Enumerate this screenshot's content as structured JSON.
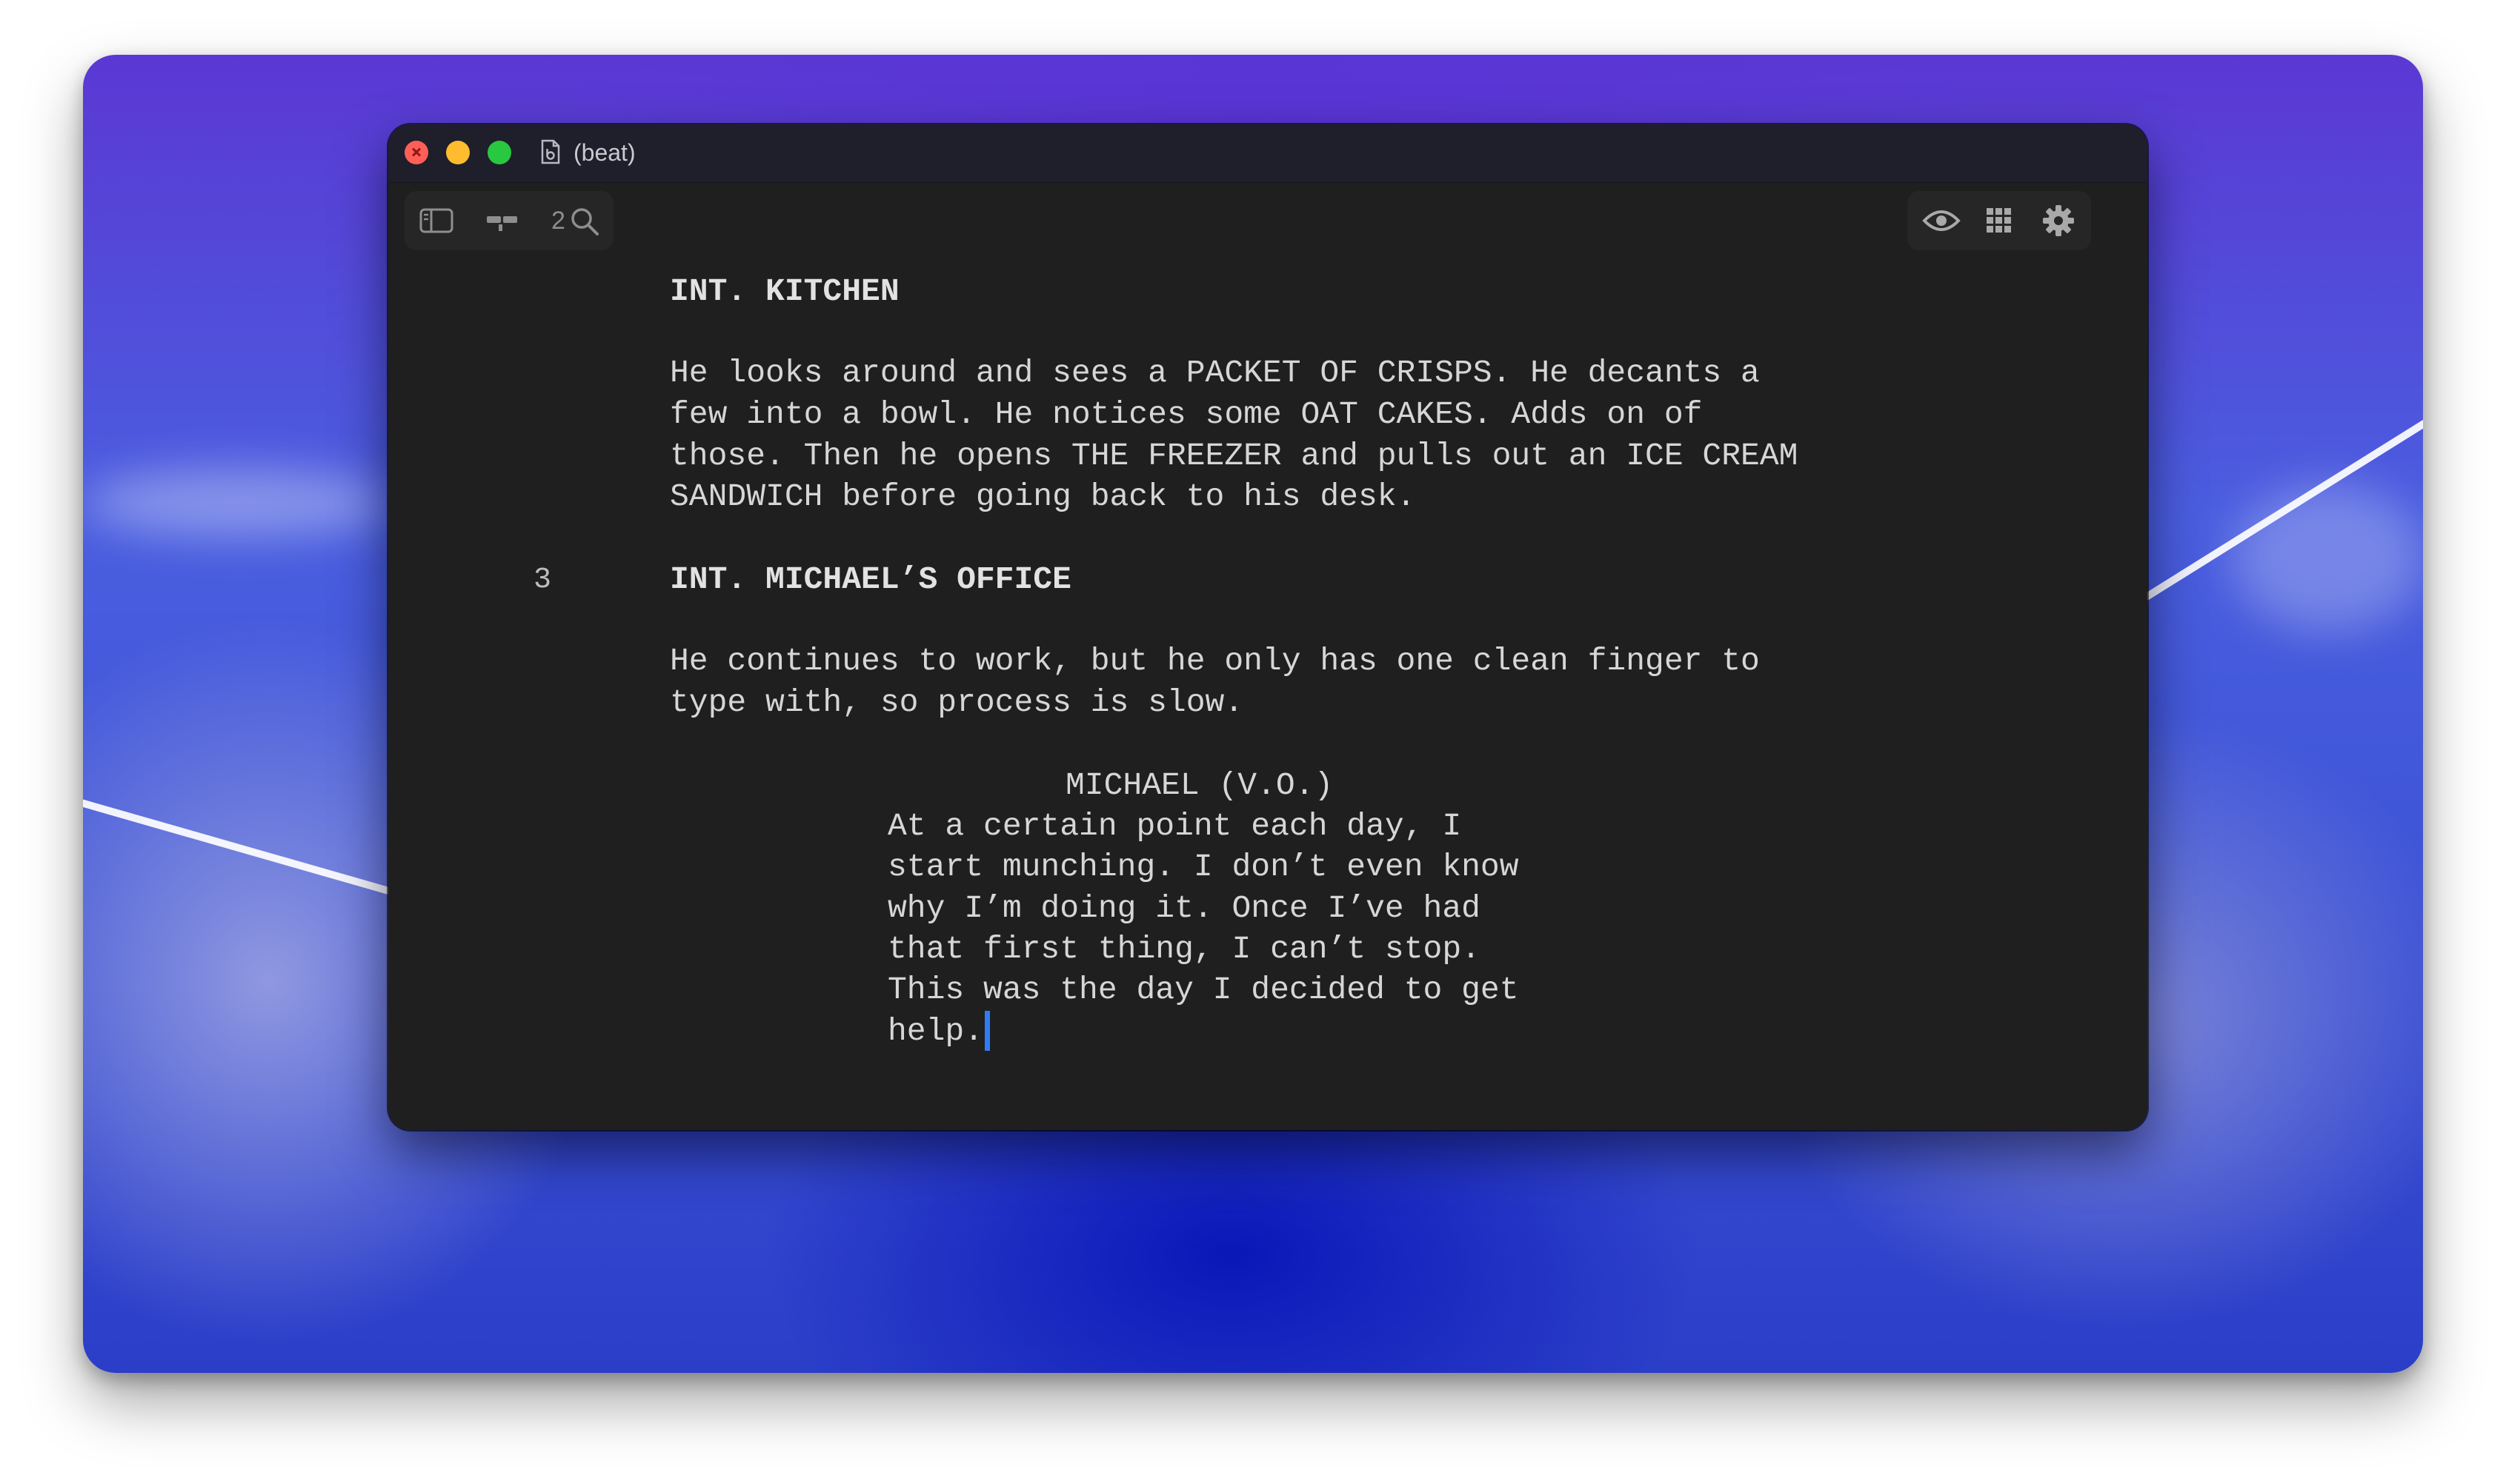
{
  "window": {
    "title": "(beat)"
  },
  "toolbar": {
    "left_icons": [
      "sidebar-icon",
      "cards-icon",
      "zoom-icon"
    ],
    "zoom_level": "2",
    "right_icons": [
      "eye-icon",
      "grid-icon",
      "gear-icon"
    ]
  },
  "script": {
    "scene2_heading": "INT. KITCHEN",
    "scene2_action": [
      "He looks around and sees a PACKET OF CRISPS. He decants a",
      "few into a bowl. He notices some OAT CAKES. Adds on of",
      "those. Then he opens THE FREEZER and pulls out an ICE CREAM",
      "SANDWICH before going back to his desk."
    ],
    "scene3_number": "3",
    "scene3_heading": "INT. MICHAEL’S OFFICE",
    "scene3_action": [
      "He continues to work, but he only has one clean finger to",
      "type with, so process is slow."
    ],
    "character": "MICHAEL (V.O.)",
    "dialogue": [
      "At a certain point each day, I",
      "start munching. I don’t even know",
      "why I’m doing it. Once I’ve had",
      "that first thing, I can’t stop.",
      "This was the day I decided to get",
      "help."
    ]
  },
  "colors": {
    "cursor": "#2f7cf6",
    "editor_background": "#1f1f1f",
    "text": "#d6d6d6"
  }
}
